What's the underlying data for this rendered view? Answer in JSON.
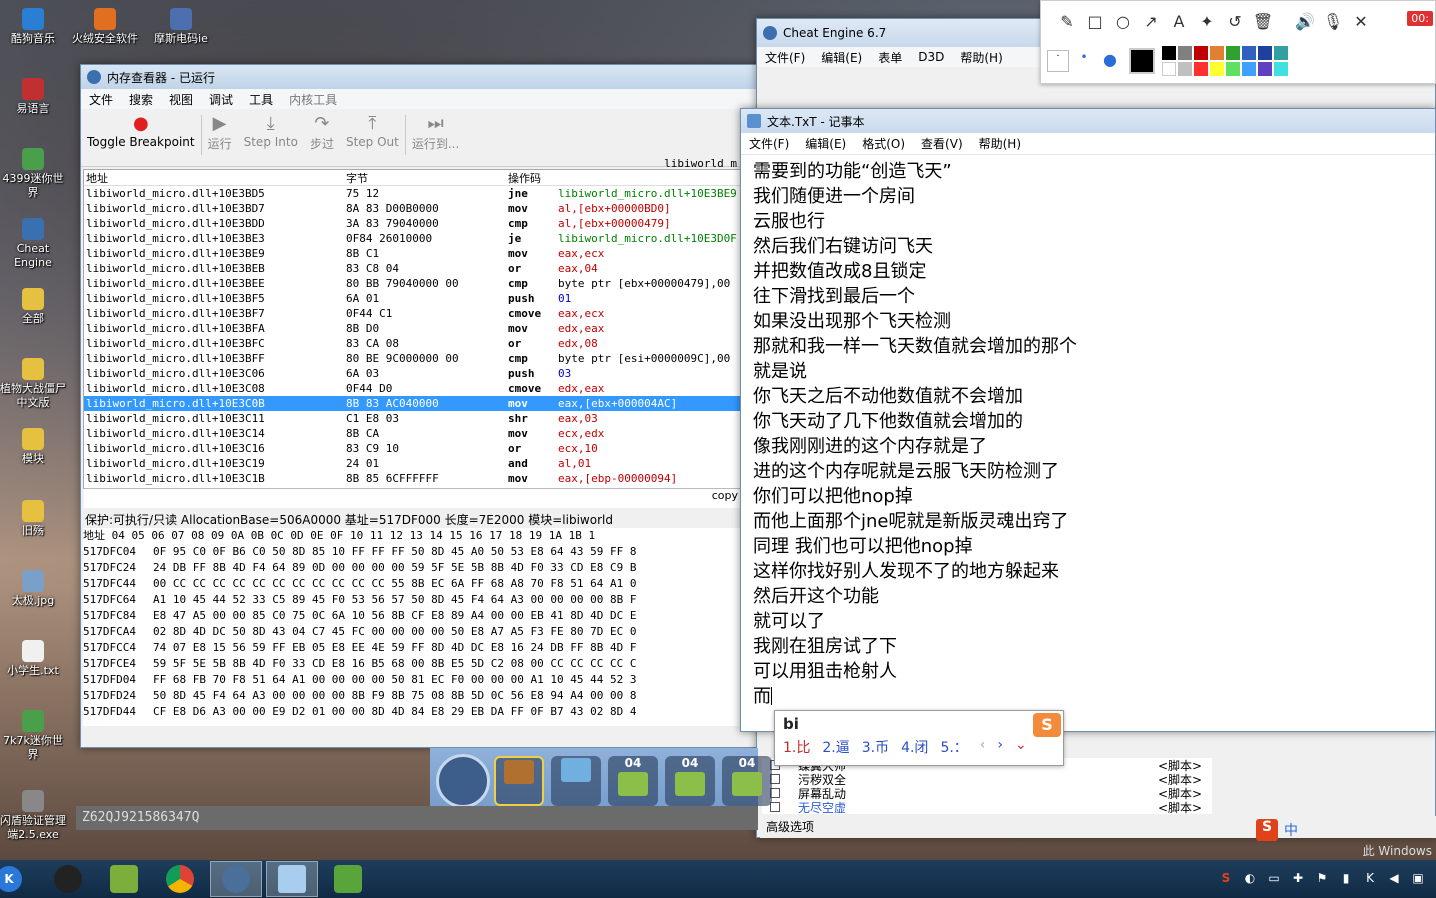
{
  "desktop": {
    "icons": [
      {
        "label": "酷狗音乐",
        "color": "#2a7fd4"
      },
      {
        "label": "火绒安全软件",
        "color": "#e07020"
      },
      {
        "label": "摩斯电码ie",
        "color": "#4d6fb0"
      },
      {
        "label": "易语言",
        "color": "#c03030"
      },
      {
        "label": "4399迷你世界",
        "color": "#4aa04a"
      },
      {
        "label": "Cheat Engine",
        "color": "#3a6fb0"
      },
      {
        "label": "全部",
        "color": "#e6c040"
      },
      {
        "label": "植物大战僵尸中文版",
        "color": "#e6c040"
      },
      {
        "label": "模块",
        "color": "#e6c040"
      },
      {
        "label": "旧殇",
        "color": "#e6c040"
      },
      {
        "label": "太极.jpg",
        "color": "#7aa0c8"
      },
      {
        "label": "小学生.txt",
        "color": "#f0f0f0"
      },
      {
        "label": "7k7k迷你世界",
        "color": "#4aa04a"
      },
      {
        "label": "闪盾验证管理端2.5.exe",
        "color": "#888888"
      }
    ]
  },
  "memview": {
    "title": "内存查看器 - 已运行",
    "menu": [
      "文件",
      "搜索",
      "视图",
      "调试",
      "工具",
      "内核工具"
    ],
    "toolbar": {
      "breakpoint": "Toggle Breakpoint",
      "run": "运行",
      "step_into": "Step Into",
      "step_over": "步过",
      "step_out": "Step Out",
      "run_to": "运行到..."
    },
    "module_label": "libiworld_m",
    "columns": {
      "addr": "地址",
      "bytes": "字节",
      "opcode": "操作码"
    },
    "rows": [
      {
        "addr": "libiworld_micro.dll+10E3BD5",
        "bytes": "75 12",
        "op": "jne",
        "arg": "libiworld_micro.dll+10E3BE9",
        "cls": "green"
      },
      {
        "addr": "libiworld_micro.dll+10E3BD7",
        "bytes": "8A 83 D00B0000",
        "op": "mov",
        "arg": "al,[ebx+00000BD0]",
        "cls": "red"
      },
      {
        "addr": "libiworld_micro.dll+10E3BDD",
        "bytes": "3A 83 79040000",
        "op": "cmp",
        "arg": "al,[ebx+00000479]",
        "cls": "red"
      },
      {
        "addr": "libiworld_micro.dll+10E3BE3",
        "bytes": "0F84 26010000",
        "op": "je",
        "arg": "libiworld_micro.dll+10E3D0F",
        "cls": "green"
      },
      {
        "addr": "libiworld_micro.dll+10E3BE9",
        "bytes": "8B C1",
        "op": "mov",
        "arg": "eax,ecx",
        "cls": "red"
      },
      {
        "addr": "libiworld_micro.dll+10E3BEB",
        "bytes": "83 C8 04",
        "op": "or",
        "arg": "eax,04",
        "cls": "red"
      },
      {
        "addr": "libiworld_micro.dll+10E3BEE",
        "bytes": "80 BB 79040000 00",
        "op": "cmp",
        "arg": "byte ptr [ebx+00000479],00",
        "cls": "plain"
      },
      {
        "addr": "libiworld_micro.dll+10E3BF5",
        "bytes": "6A 01",
        "op": "push",
        "arg": "01",
        "cls": "blue"
      },
      {
        "addr": "libiworld_micro.dll+10E3BF7",
        "bytes": "0F44 C1",
        "op": "cmove",
        "arg": "eax,ecx",
        "cls": "red"
      },
      {
        "addr": "libiworld_micro.dll+10E3BFA",
        "bytes": "8B D0",
        "op": "mov",
        "arg": "edx,eax",
        "cls": "red"
      },
      {
        "addr": "libiworld_micro.dll+10E3BFC",
        "bytes": "83 CA 08",
        "op": "or",
        "arg": "edx,08",
        "cls": "red"
      },
      {
        "addr": "libiworld_micro.dll+10E3BFF",
        "bytes": "80 BE 9C000000 00",
        "op": "cmp",
        "arg": "byte ptr [esi+0000009C],00",
        "cls": "plain"
      },
      {
        "addr": "libiworld_micro.dll+10E3C06",
        "bytes": "6A 03",
        "op": "push",
        "arg": "03",
        "cls": "blue"
      },
      {
        "addr": "libiworld_micro.dll+10E3C08",
        "bytes": "0F44 D0",
        "op": "cmove",
        "arg": "edx,eax",
        "cls": "red"
      },
      {
        "addr": "libiworld_micro.dll+10E3C0B",
        "bytes": "8B 83 AC040000",
        "op": "mov",
        "arg": "eax,[ebx+000004AC]",
        "cls": "sel"
      },
      {
        "addr": "libiworld_micro.dll+10E3C11",
        "bytes": "C1 E8 03",
        "op": "shr",
        "arg": "eax,03",
        "cls": "red"
      },
      {
        "addr": "libiworld_micro.dll+10E3C14",
        "bytes": "8B CA",
        "op": "mov",
        "arg": "ecx,edx",
        "cls": "red"
      },
      {
        "addr": "libiworld_micro.dll+10E3C16",
        "bytes": "83 C9 10",
        "op": "or",
        "arg": "ecx,10",
        "cls": "red"
      },
      {
        "addr": "libiworld_micro.dll+10E3C19",
        "bytes": "24 01",
        "op": "and",
        "arg": "al,01",
        "cls": "red"
      },
      {
        "addr": "libiworld_micro.dll+10E3C1B",
        "bytes": "8B 85 6CFFFFFF",
        "op": "mov",
        "arg": "eax,[ebp-00000094]",
        "cls": "red"
      }
    ],
    "copy_label": "copy",
    "hex_info": "保护:可执行/只读  AllocationBase=506A0000  基址=517DF000  长度=7E2000  模块=libiworld",
    "hex_header": "地址     04 05 06 07 08 09 0A 0B 0C 0D 0E 0F 10 11 12 13 14 15 16 17 18 19 1A 1B 1",
    "hex_rows": [
      {
        "addr": "517DFC04",
        "bytes": "0F 95 C0 0F B6 C0 50 8D 85 10 FF FF FF 50 8D 45 A0 50 53 E8 64 43 59 FF 8"
      },
      {
        "addr": "517DFC24",
        "bytes": "24 DB FF 8B 4D F4 64 89 0D 00 00 00 00 59 5F 5E 5B 8B 4D F0 33 CD E8 C9 B"
      },
      {
        "addr": "517DFC44",
        "bytes": "00 CC CC CC CC CC CC CC CC CC CC CC 55 8B EC 6A FF 68 A8 70 F8 51 64 A1 0"
      },
      {
        "addr": "517DFC64",
        "bytes": "A1 10 45 44 52 33 C5 89 45 F0 53 56 57 50 8D 45 F4 64 A3 00 00 00 00 8B F"
      },
      {
        "addr": "517DFC84",
        "bytes": "E8 47 A5 00 00 85 C0 75 0C 6A 10 56 8B CF E8 89 A4 00 00 EB 41 8D 4D DC E"
      },
      {
        "addr": "517DFCA4",
        "bytes": "02 8D 4D DC 50 8D 43 04 C7 45 FC 00 00 00 00 50 E8 A7 A5 F3 FE 80 7D EC 0"
      },
      {
        "addr": "517DFCC4",
        "bytes": "74 07 E8 15 56 59 FF EB 05 E8 EE 4E 59 FF 8D 4D DC E8 16 24 DB FF 8B 4D F"
      },
      {
        "addr": "517DFCE4",
        "bytes": "59 5F 5E 5B 8B 4D F0 33 CD E8 16 B5 68 00 8B E5 5D C2 08 00 CC CC CC CC C"
      },
      {
        "addr": "517DFD04",
        "bytes": "FF 68 FB 70 F8 51 64 A1 00 00 00 00 50 81 EC F0 00 00 00 A1 10 45 44 52 3"
      },
      {
        "addr": "517DFD24",
        "bytes": "50 8D 45 F4 64 A3 00 00 00 00 8B F9 8B 75 08 8B 5D 0C 56 E8 94 A4 00 00 8"
      },
      {
        "addr": "517DFD44",
        "bytes": "CF E8 D6 A3 00 00 E9 D2 01 00 00 8D 4D 84 E8 29 EB DA FF 0F B7 43 02 8D 4"
      }
    ]
  },
  "cheatengine": {
    "title": "Cheat Engine 6.7",
    "menu": [
      "文件(F)",
      "编辑(E)",
      "表单",
      "D3D",
      "帮助(H)"
    ],
    "list": [
      {
        "name": "蝶翼大师",
        "tag": "<脚本>"
      },
      {
        "name": "污秽双全",
        "tag": "<脚本>"
      },
      {
        "name": "屏幕乱动",
        "tag": "<脚本>"
      },
      {
        "name": "无尽空虚",
        "tag": "<脚本>"
      }
    ],
    "advanced": "高级选项"
  },
  "notepad": {
    "title": "文本.TxT - 记事本",
    "menu": [
      "文件(F)",
      "编辑(E)",
      "格式(O)",
      "查看(V)",
      "帮助(H)"
    ],
    "lines": [
      "需要到的功能“创造飞天”",
      "我们随便进一个房间",
      "云服也行",
      "然后我们右键访问飞天",
      "并把数值改成8且锁定",
      "往下滑找到最后一个",
      "如果没出现那个飞天检测",
      "那就和我一样一飞天数值就会增加的那个",
      "就是说",
      "你飞天之后不动他数值就不会增加",
      "你飞天动了几下他数值就会增加的",
      "像我刚刚进的这个内存就是了",
      "进的这个内存呢就是云服飞天防检测了",
      "你们可以把他nop掉",
      "而他上面那个jne呢就是新版灵魂出窍了",
      "同理 我们也可以把他nop掉",
      "这样你找好别人发现不了的地方躲起来",
      "然后开这个功能",
      "就可以了",
      "我刚在狙房试了下",
      "可以用狙击枪射人"
    ],
    "current_line": "而"
  },
  "ime": {
    "composition": "bi",
    "candidates": [
      "1.比",
      "2.逼",
      "3.币",
      "4.闭",
      "5.："
    ],
    "logo": "S"
  },
  "annot": {
    "tools": [
      "✎",
      "□",
      "○",
      "↗",
      "A",
      "✦",
      "↺",
      "🗑",
      "🔊",
      "🎙",
      "✕"
    ],
    "record_time": "00:",
    "colors": [
      "#000000",
      "#808080",
      "#c00000",
      "#e08030",
      "#30a030",
      "#3060c0",
      "#2040a0",
      "#30a0a0",
      "#ffffff",
      "#c0c0c0",
      "#ff3030",
      "#ffff30",
      "#60e060",
      "#40a0ff",
      "#6040c0",
      "#40e0e0"
    ]
  },
  "game": {
    "slots": [
      {
        "num": "1",
        "count": ""
      },
      {
        "num": "2",
        "count": ""
      },
      {
        "num": "3",
        "count": "04"
      },
      {
        "num": "4",
        "count": "04"
      },
      {
        "num": "5",
        "count": "04"
      }
    ],
    "player_id": "Z62QJ921586347Q"
  },
  "taskbar": {
    "apps": [
      "qq-icon",
      "game-icon",
      "chrome-icon",
      "cheat-engine-icon",
      "notepad-icon",
      "game2-icon"
    ],
    "tray_text": "此 Windows",
    "ime_status": "中"
  }
}
